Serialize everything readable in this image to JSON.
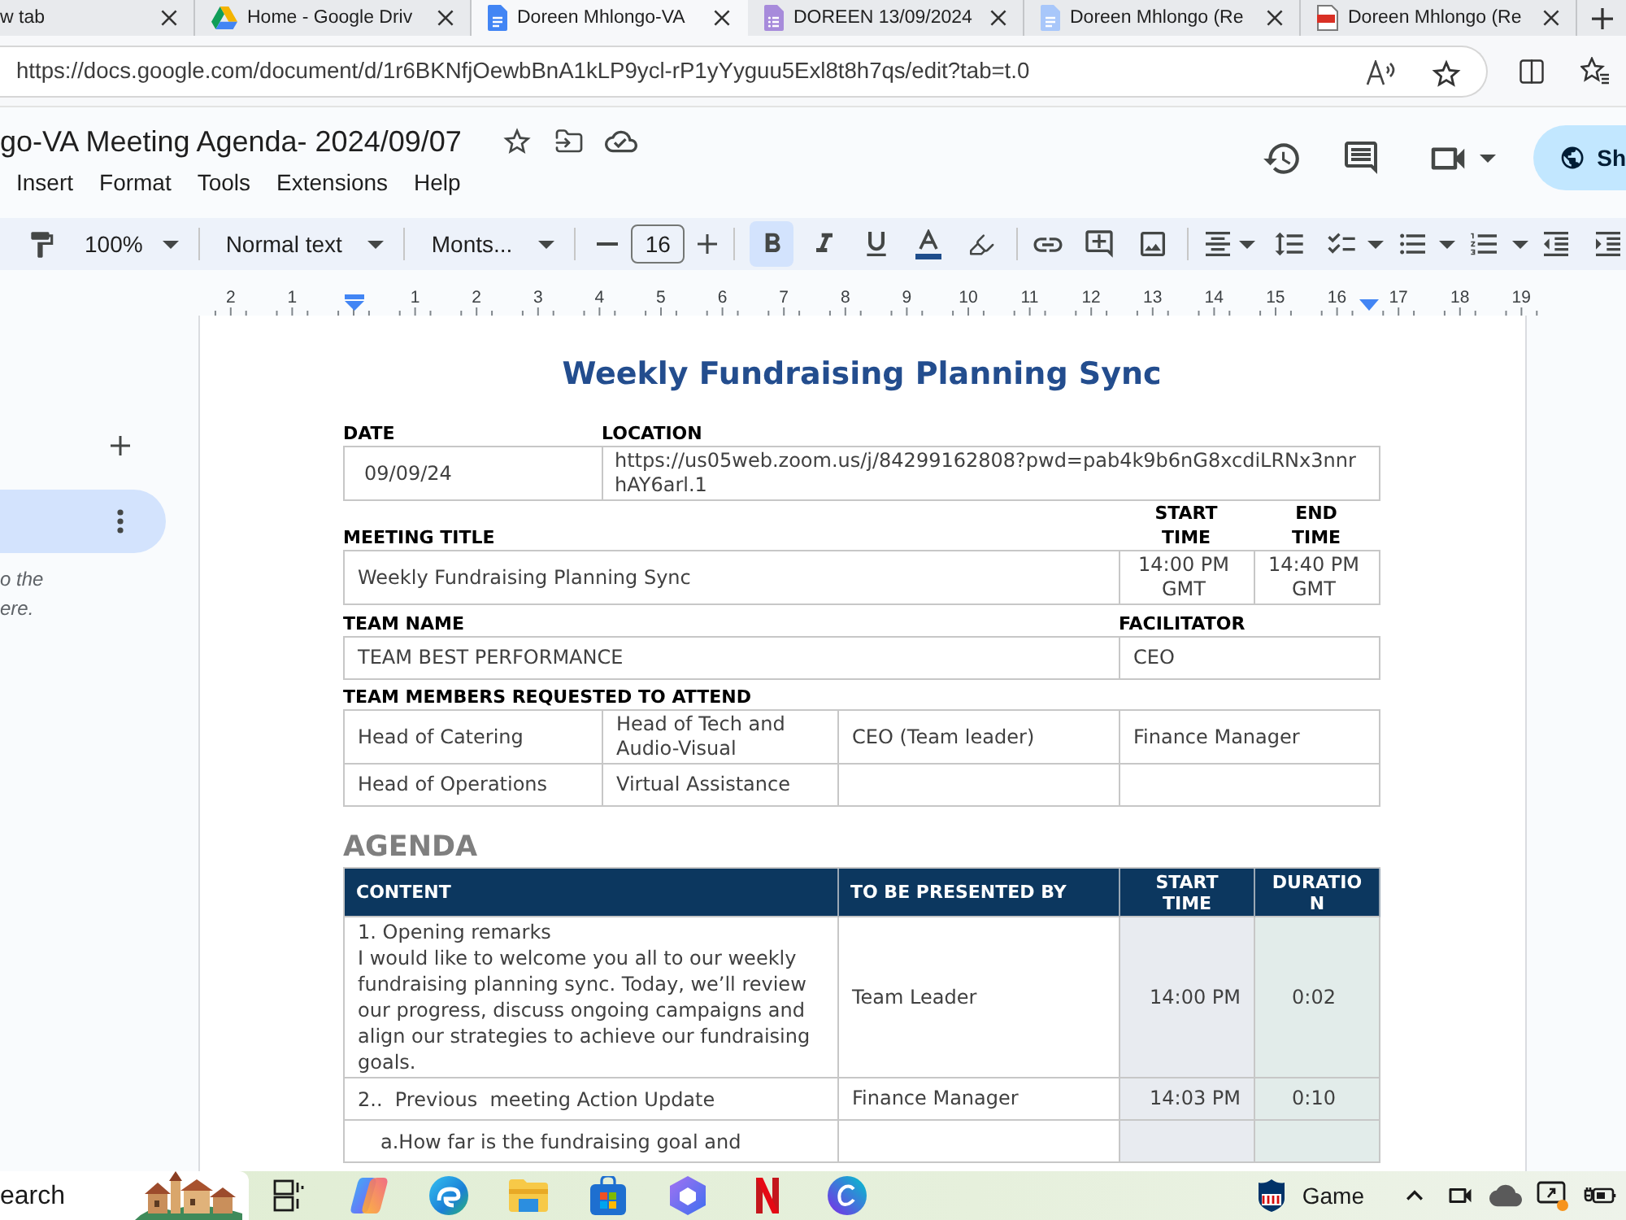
{
  "browser": {
    "tabs": [
      {
        "title": "w tab",
        "kind": "plain",
        "selected": false
      },
      {
        "title": "Home - Google Driv",
        "kind": "drive",
        "selected": false
      },
      {
        "title": "Doreen Mhlongo-VA",
        "kind": "doc",
        "selected": true
      },
      {
        "title": "DOREEN 13/09/2024",
        "kind": "form",
        "selected": false
      },
      {
        "title": "Doreen Mhlongo (Re",
        "kind": "doc",
        "selected": false
      },
      {
        "title": "Doreen Mhlongo (Re",
        "kind": "pdf",
        "selected": false
      }
    ],
    "url": "https://docs.google.com/document/d/1r6BKNfjOewbBnA1kLP9ycl-rP1yYyguu5Exl8t8h7qs/edit?tab=t.0"
  },
  "docs": {
    "title": "go-VA Meeting Agenda- 2024/09/07",
    "menus": [
      "Insert",
      "Format",
      "Tools",
      "Extensions",
      "Help"
    ],
    "share": "Sh"
  },
  "toolbar": {
    "zoom": "100%",
    "style": "Normal text",
    "font": "Monts...",
    "font_size": "16",
    "bold": true,
    "italic": false,
    "underline": false
  },
  "ruler": {
    "before": [
      "2",
      "1"
    ],
    "after": [
      "1",
      "2",
      "3",
      "4",
      "5",
      "6",
      "7",
      "8",
      "9",
      "10",
      "11",
      "12",
      "13",
      "14",
      "15",
      "16",
      "17",
      "18",
      "19"
    ]
  },
  "sidebar": {
    "tabs": [
      {
        "selected": true
      }
    ],
    "note": [
      "o the",
      "ere."
    ]
  },
  "document": {
    "title": "Weekly Fundraising Planning Sync",
    "date": {
      "label": "DATE",
      "value": "09/09/24"
    },
    "location": {
      "label": "LOCATION",
      "value": "https://us05web.zoom.us/j/84299162808?pwd=pab4k9b6nG8xcdiLRNx3nnrhAY6arl.1"
    },
    "meeting": {
      "label": "MEETING TITLE",
      "value": "Weekly Fundraising Planning Sync"
    },
    "start": {
      "label": "START TIME",
      "value": "14:00 PM GMT"
    },
    "end": {
      "label": "END TIME",
      "value": "14:40 PM GMT"
    },
    "team": {
      "label": "TEAM NAME",
      "value": "TEAM BEST PERFORMANCE"
    },
    "facilitator": {
      "label": "FACILITATOR",
      "value": "CEO"
    },
    "members": {
      "label": "TEAM MEMBERS REQUESTED TO ATTEND",
      "rows": [
        [
          "Head of Catering",
          "Head of Tech and Audio-Visual",
          "CEO (Team leader)",
          "Finance Manager"
        ],
        [
          "Head of Operations",
          "Virtual Assistance"
        ]
      ]
    },
    "agenda": {
      "heading": "AGENDA",
      "columns": [
        "CONTENT",
        "TO BE PRESENTED BY",
        "START TIME",
        "DURATION"
      ],
      "rows": [
        {
          "kind": "item",
          "content": [
            "1. Opening remarks",
            "I would like to welcome you all to our weekly fundraising planning sync. Today, we’ll review our progress, discuss ongoing campaigns and align our strategies to achieve our fundraising goals."
          ],
          "presenter": "Team Leader",
          "start": "14:00 PM",
          "duration": "0:02"
        },
        {
          "kind": "item",
          "content": [
            "2..  Previous  meeting Action Update"
          ],
          "presenter": "Finance Manager",
          "start": "14:03 PM",
          "duration": "0:10"
        },
        {
          "kind": "subitem",
          "content": [
            "a.How far is the fundraising goal and"
          ]
        }
      ]
    }
  },
  "taskbar": {
    "search": {
      "placeholder": "earch"
    },
    "widget": "Game"
  }
}
